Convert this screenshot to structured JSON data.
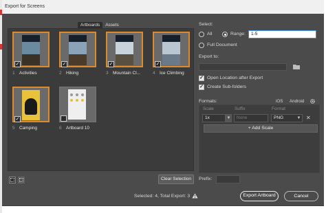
{
  "window": {
    "title": "Export for Screens"
  },
  "tabs": [
    {
      "label": "Artboards",
      "active": true
    },
    {
      "label": "Assets",
      "active": false
    }
  ],
  "artboards": [
    {
      "num": "1",
      "name": "Activities",
      "selected": true,
      "kind": "photo"
    },
    {
      "num": "2",
      "name": "Hiking",
      "selected": true,
      "kind": "photo"
    },
    {
      "num": "3",
      "name": "Mountain Cl...",
      "selected": true,
      "kind": "photo"
    },
    {
      "num": "4",
      "name": "Ice Climbing",
      "selected": true,
      "kind": "photo"
    },
    {
      "num": "5",
      "name": "Camping",
      "selected": true,
      "kind": "camping"
    },
    {
      "num": "6",
      "name": "Artboard 10",
      "selected": false,
      "kind": "blank"
    }
  ],
  "gallery": {
    "clear_selection": "Clear Selection"
  },
  "select": {
    "heading": "Select:",
    "all_label": "All",
    "range_label": "Range:",
    "range_value": "1-5",
    "full_document_label": "Full Document",
    "selected_option": "Range"
  },
  "export_to": {
    "heading": "Export to:",
    "path": "",
    "open_location_label": "Open Location after Export",
    "open_location_checked": true,
    "create_subfolders_label": "Create Sub-folders",
    "create_subfolders_checked": true
  },
  "formats": {
    "heading": "Formats:",
    "ios_label": "iOS",
    "android_label": "Android",
    "columns": {
      "scale": "Scale",
      "suffix": "Suffix",
      "format": "Format"
    },
    "rows": [
      {
        "scale": "1x",
        "suffix": "None",
        "format": "PNG"
      }
    ],
    "add_scale": "+ Add Scale"
  },
  "prefix": {
    "label": "Prefix:",
    "value": ""
  },
  "footer": {
    "status": "Selected: 4, Total Export: 3",
    "export_button": "Export Artboard",
    "cancel_button": "Cancel"
  },
  "colors": {
    "accent_orange": "#e08a2e",
    "focus_blue": "#3b8ee0",
    "panel": "#4b4b4b"
  }
}
